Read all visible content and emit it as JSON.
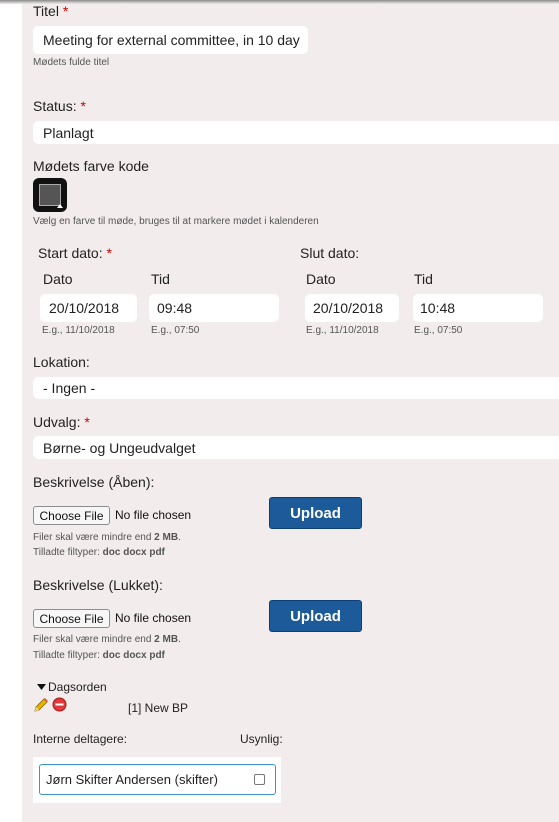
{
  "form": {
    "title_label": "Titel",
    "title_value": "Meeting for external committee, in 10 day",
    "title_help": "Mødets fulde titel",
    "status_label": "Status:",
    "status_value": "Planlagt",
    "color_label": "Mødets farve kode",
    "color_help": "Vælg en farve til møde, bruges til at markere mødet i kalenderen",
    "start_label": "Start dato:",
    "end_label": "Slut dato:",
    "date_sublabel": "Dato",
    "time_sublabel": "Tid",
    "start_date": "20/10/2018",
    "start_time": "09:48",
    "end_date": "20/10/2018",
    "end_time": "10:48",
    "date_hint": "E.g., 11/10/2018",
    "time_hint": "E.g., 07:50",
    "location_label": "Lokation:",
    "location_value": "- Ingen -",
    "committee_label": "Udvalg:",
    "committee_value": "Børne- og Ungeudvalget",
    "required_mark": "*"
  },
  "uploads": {
    "open_label": "Beskrivelse (Åben):",
    "closed_label": "Beskrivelse (Lukket):",
    "choose_file": "Choose File",
    "no_file": "No file chosen",
    "upload_button": "Upload",
    "size_prefix": "Filer skal være mindre end ",
    "size_value": "2 MB",
    "size_suffix": ".",
    "types_prefix": "Tilladte filtyper: ",
    "types_value": "doc docx pdf"
  },
  "agenda": {
    "toggle_label": "Dagsorden",
    "item_text": "[1] New BP"
  },
  "participants": {
    "internal_label": "Interne deltagere:",
    "invisible_label": "Usynlig:",
    "person": "Jørn Skifter Andersen (skifter)"
  },
  "colors": {
    "panel_bg": "#f2ecec",
    "upload_button": "#1d5a9a",
    "required": "#cc0000",
    "participant_border": "#3f94c6"
  }
}
